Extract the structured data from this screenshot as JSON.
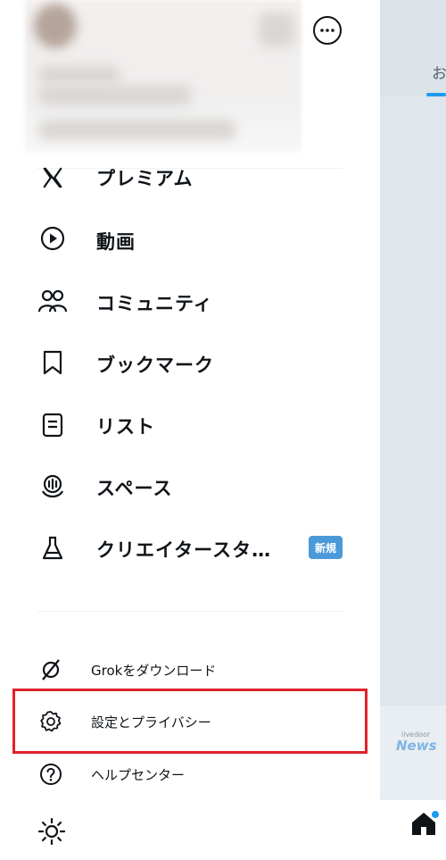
{
  "menu": {
    "items": [
      {
        "label": "プレミアム",
        "icon": "x-logo-icon"
      },
      {
        "label": "動画",
        "icon": "play-circle-icon"
      },
      {
        "label": "コミュニティ",
        "icon": "communities-icon"
      },
      {
        "label": "ブックマーク",
        "icon": "bookmark-icon"
      },
      {
        "label": "リスト",
        "icon": "list-icon"
      },
      {
        "label": "スペース",
        "icon": "spaces-mic-icon"
      },
      {
        "label": "クリエイタースタ…",
        "icon": "flask-icon",
        "badge": "新規"
      }
    ]
  },
  "secondary": {
    "items": [
      {
        "label": "Grokをダウンロード",
        "icon": "grok-icon"
      },
      {
        "label": "設定とプライバシー",
        "icon": "gear-icon",
        "highlighted": true
      },
      {
        "label": "ヘルプセンター",
        "icon": "help-icon"
      }
    ]
  },
  "right_pane": {
    "tab_text": "お",
    "banner_small": "livedoor",
    "banner_title": "News"
  },
  "colors": {
    "accent": "#1d9bf0",
    "badge": "#4b99d8",
    "highlight": "#e0212b"
  }
}
